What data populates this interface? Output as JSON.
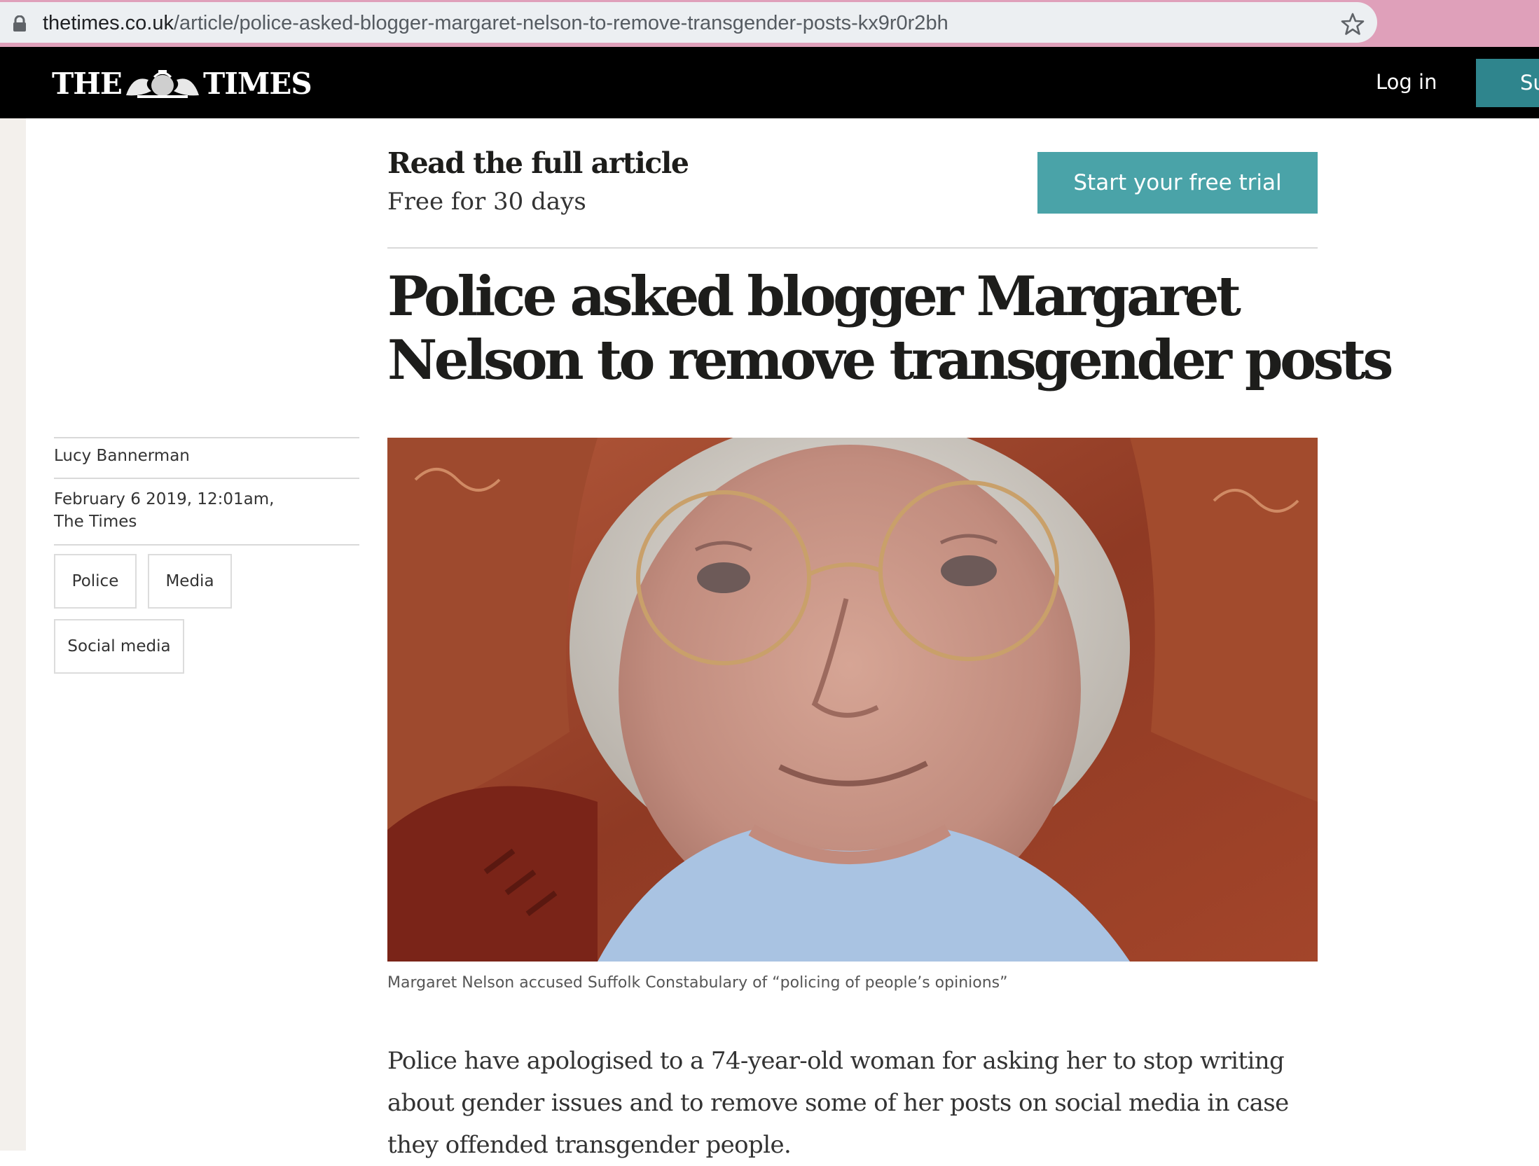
{
  "browser": {
    "url_host": "thetimes.co.uk",
    "url_path": "/article/police-asked-blogger-margaret-nelson-to-remove-transgender-posts-kx9r0r2bh",
    "icons": [
      "lock-icon",
      "star-icon"
    ]
  },
  "header": {
    "logo_left": "THE",
    "logo_right": "TIMES",
    "login_label": "Log in",
    "subscribe_label": "Su",
    "accent_color": "#2f858d"
  },
  "cta": {
    "title": "Read the full article",
    "subtitle": "Free for 30 days",
    "button_label": "Start your free trial",
    "button_color": "#4aa3a8"
  },
  "article": {
    "headline_line1": "Police asked blogger Margaret",
    "headline_line2": "Nelson to remove transgender posts",
    "author": "Lucy Bannerman",
    "date_line1": "February 6 2019, 12:01am,",
    "date_line2": "The Times",
    "tags": [
      "Police",
      "Media",
      "Social media"
    ],
    "caption": "Margaret Nelson accused Suffolk Constabulary of “policing of people’s opinions”",
    "body_line1": "Police have apologised to a 74-year-old woman for asking her to stop writing",
    "body_line2": "about gender issues and to remove some of her posts on social media in case",
    "body_line3": "they offended transgender people."
  }
}
